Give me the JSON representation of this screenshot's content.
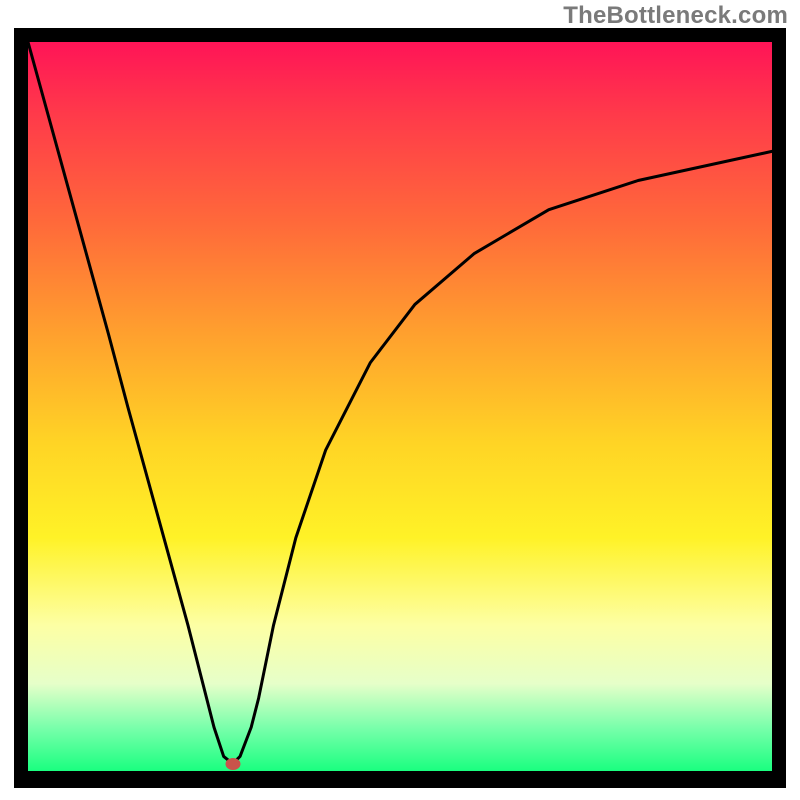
{
  "watermark": "TheBottleneck.com",
  "chart_data": {
    "type": "line",
    "title": "",
    "xlabel": "",
    "ylabel": "",
    "ylim": [
      0,
      100
    ],
    "xlim": [
      0,
      100
    ],
    "x": [
      0,
      2.7,
      5.4,
      8.1,
      10.8,
      13.4,
      16.1,
      18.8,
      21.5,
      23.5,
      25.0,
      26.3,
      27.5,
      28.5,
      30.0,
      31.0,
      33.0,
      36.0,
      40.0,
      46.0,
      52.0,
      60.0,
      70.0,
      82.0,
      100.0
    ],
    "values": [
      100,
      90,
      80,
      70,
      60,
      50,
      40,
      30,
      20,
      12,
      6,
      2,
      1,
      2,
      6,
      10,
      20,
      32,
      44,
      56,
      64,
      71,
      77,
      81,
      85
    ],
    "marker": {
      "x": 27.5,
      "y": 1
    }
  },
  "colors": {
    "curve": "#000000",
    "dot": "#c9534b",
    "frame": "#000000"
  }
}
